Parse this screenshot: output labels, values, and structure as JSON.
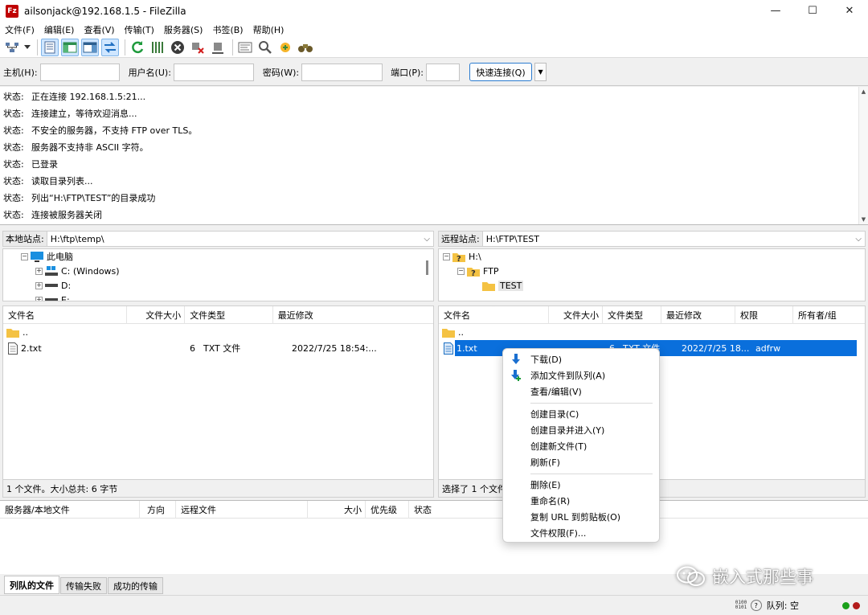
{
  "window": {
    "title": "ailsonjack@192.168.1.5 - FileZilla",
    "app_icon": "Fz",
    "minimize": "—",
    "maximize": "☐",
    "close": "✕"
  },
  "menu": [
    "文件(F)",
    "编辑(E)",
    "查看(V)",
    "传输(T)",
    "服务器(S)",
    "书签(B)",
    "帮助(H)"
  ],
  "toolbar_icons": [
    "site-manager-icon",
    "dropdown-icon",
    "message-log-icon",
    "local-tree-icon",
    "remote-tree-icon",
    "transfer-queue-icon",
    "refresh-icon",
    "process-queue-icon",
    "cancel-icon",
    "disconnect-icon",
    "reconnect-icon",
    "filter-icon",
    "comparison-icon",
    "sync-browse-icon",
    "search-icon"
  ],
  "quickconnect": {
    "host_label": "主机(H):",
    "user_label": "用户名(U):",
    "pass_label": "密码(W):",
    "port_label": "端口(P):",
    "button": "快速连接(Q)",
    "host": "",
    "user": "",
    "pass": "",
    "port": ""
  },
  "log": [
    {
      "label": "状态:",
      "text": "正在连接 192.168.1.5:21..."
    },
    {
      "label": "状态:",
      "text": "连接建立，等待欢迎消息..."
    },
    {
      "label": "状态:",
      "text": "不安全的服务器，不支持 FTP over TLS。"
    },
    {
      "label": "状态:",
      "text": "服务器不支持非 ASCII 字符。"
    },
    {
      "label": "状态:",
      "text": "已登录"
    },
    {
      "label": "状态:",
      "text": "读取目录列表..."
    },
    {
      "label": "状态:",
      "text": "列出“H:\\FTP\\TEST”的目录成功"
    },
    {
      "label": "状态:",
      "text": "连接被服务器关闭"
    }
  ],
  "local": {
    "site_label": "本地站点:",
    "path": "H:\\ftp\\temp\\",
    "tree": {
      "pc": "此电脑",
      "c": "C: (Windows)",
      "d": "D:",
      "e": "E:"
    },
    "columns": {
      "name": "文件名",
      "size": "文件大小",
      "type": "文件类型",
      "modified": "最近修改"
    },
    "parent": "..",
    "files": [
      {
        "name": "2.txt",
        "size": "6",
        "type": "TXT 文件",
        "modified": "2022/7/25 18:54:..."
      }
    ],
    "status": "1 个文件。大小总共: 6 字节"
  },
  "remote": {
    "site_label": "远程站点:",
    "path": "H:\\FTP\\TEST",
    "tree": {
      "root": "H:\\",
      "ftp": "FTP",
      "test": "TEST"
    },
    "columns": {
      "name": "文件名",
      "size": "文件大小",
      "type": "文件类型",
      "modified": "最近修改",
      "perms": "权限",
      "owner": "所有者/组"
    },
    "parent": "..",
    "files": [
      {
        "name": "1.txt",
        "size": "6",
        "type": "TXT 文件",
        "modified": "2022/7/25 18...",
        "perms": "adfrw",
        "owner": ""
      }
    ],
    "status": "选择了 1 个文件"
  },
  "context_menu": {
    "download": "下载(D)",
    "add_queue": "添加文件到队列(A)",
    "view_edit": "查看/编辑(V)",
    "create_dir": "创建目录(C)",
    "create_dir_enter": "创建目录并进入(Y)",
    "create_file": "创建新文件(T)",
    "refresh": "刷新(F)",
    "delete": "删除(E)",
    "rename": "重命名(R)",
    "copy_url": "复制 URL 到剪贴板(O)",
    "perms": "文件权限(F)..."
  },
  "queue": {
    "columns": {
      "server": "服务器/本地文件",
      "direction": "方向",
      "remote": "远程文件",
      "size": "大小",
      "priority": "优先级",
      "status": "状态"
    }
  },
  "tabs": [
    "列队的文件",
    "传输失败",
    "成功的传输"
  ],
  "statusbar": {
    "queue": "队列: 空",
    "bin_icon": "0100 0101"
  },
  "watermark": "嵌入式那些事",
  "colors": {
    "selection": "#0a6fdc",
    "accent": "#2c7cd0",
    "led_green": "#1aa01a",
    "led_red": "#b31b1b"
  }
}
